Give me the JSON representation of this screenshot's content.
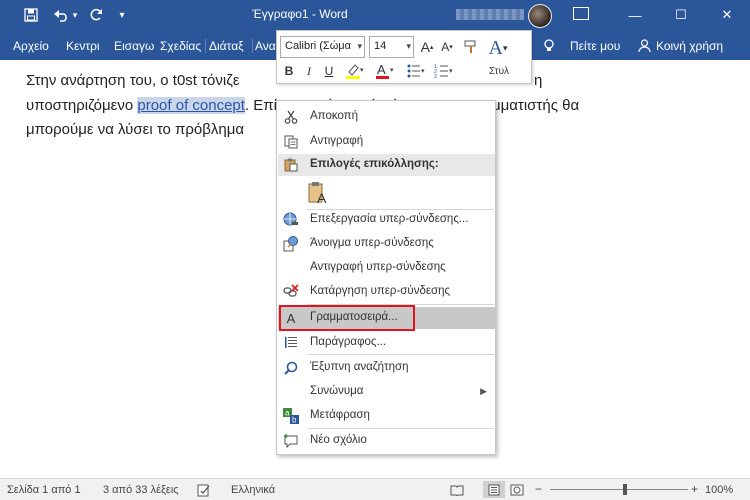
{
  "titlebar": {
    "title": "Έγγραφο1 - Word",
    "save_icon": "save-icon",
    "undo_icon": "undo-icon",
    "redo_icon": "redo-icon",
    "customize_icon": "chevron-down-icon",
    "minimize": "—",
    "maximize": "☐",
    "close": "✕"
  },
  "ribbon": {
    "tabs": [
      "Αρχείο",
      "Κεντρι",
      "Εισαγω",
      "Σχεδίας",
      "Διάταξ",
      "Ανα"
    ],
    "tell_me": "Πείτε μου",
    "share": "Κοινή χρήση"
  },
  "document": {
    "line1": "Στην ανάρτηση του, ο t0st τόνιζε",
    "line1_tail": "η",
    "line2_before": "υποστηριζόμενο ",
    "line2_link": "proof of concept",
    "line2_after": ". Επίσης, ανέφερε ότι όποιος προγραμματιστής θα",
    "line3": "μπορούμε να λύσει το πρόβλημα"
  },
  "mini_toolbar": {
    "font_name": "Calibri (Σώμα",
    "font_size": "14",
    "bold": "B",
    "italic": "I",
    "underline": "U",
    "styles_label": "Στυλ",
    "highlight_color": "#ffff00",
    "font_color": "#e0141e"
  },
  "context_menu": {
    "items": [
      {
        "label": "Αποκοπή",
        "icon": "scissors-icon"
      },
      {
        "label": "Αντιγραφή",
        "icon": "copy-icon"
      },
      {
        "label": "Επιλογές επικόλλησης:",
        "icon": "paste-icon"
      },
      {
        "label": "",
        "icon": "paste-keep-text-icon"
      },
      {
        "label": "Επεξεργασία υπερ-σύνδεσης...",
        "icon": "edit-hyperlink-icon"
      },
      {
        "label": "Άνοιγμα υπερ-σύνδεσης",
        "icon": "open-hyperlink-icon"
      },
      {
        "label": "Αντιγραφή υπερ-σύνδεσης",
        "icon": ""
      },
      {
        "label": "Κατάργηση υπερ-σύνδεσης",
        "icon": "remove-hyperlink-icon"
      },
      {
        "label": "Γραμματοσειρά...",
        "icon": "font-icon"
      },
      {
        "label": "Παράγραφος...",
        "icon": "paragraph-icon"
      },
      {
        "label": "Έξυπνη αναζήτηση",
        "icon": "smart-lookup-icon"
      },
      {
        "label": "Συνώνυμα",
        "icon": ""
      },
      {
        "label": "Μετάφραση",
        "icon": "translate-icon"
      },
      {
        "label": "Νέο σχόλιο",
        "icon": "new-comment-icon"
      }
    ]
  },
  "statusbar": {
    "page": "Σελίδα 1 από 1",
    "words": "3 από 33 λέξεις",
    "language": "Ελληνικά",
    "zoom": "100%",
    "zoom_level": 1.0
  },
  "colors": {
    "accent": "#2b579a",
    "highlight_box": "#e0141e",
    "link": "#2e54a8"
  }
}
